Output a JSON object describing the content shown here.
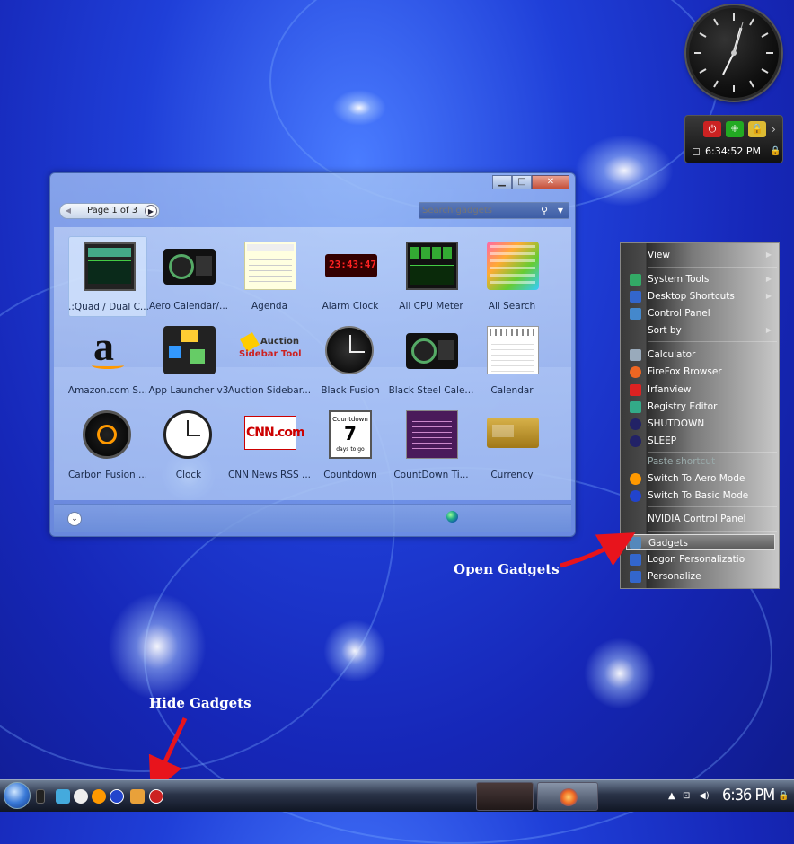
{
  "clock_gadget": {
    "label": "analog clock"
  },
  "power_gadget": {
    "time": "6:34:52 PM"
  },
  "gallery": {
    "page_text": "Page 1 of 3",
    "search_placeholder": "Search gadgets",
    "gadgets": [
      {
        "label": ".:Quad / Dual C...",
        "thumb": "cpu-meter"
      },
      {
        "label": "Aero Calendar/...",
        "thumb": "aero-calendar"
      },
      {
        "label": "Agenda",
        "thumb": "agenda"
      },
      {
        "label": "Alarm Clock",
        "thumb": "alarm-clock"
      },
      {
        "label": "All CPU Meter",
        "thumb": "all-cpu-meter"
      },
      {
        "label": "All Search",
        "thumb": "all-search"
      },
      {
        "label": "Amazon.com S...",
        "thumb": "amazon"
      },
      {
        "label": "App Launcher v3",
        "thumb": "app-launcher"
      },
      {
        "label": "Auction Sidebar...",
        "thumb": "auction-sidebar"
      },
      {
        "label": "Black Fusion",
        "thumb": "black-fusion"
      },
      {
        "label": "Black Steel Cale...",
        "thumb": "black-steel"
      },
      {
        "label": "Calendar",
        "thumb": "calendar"
      },
      {
        "label": "Carbon Fusion ...",
        "thumb": "carbon-fusion"
      },
      {
        "label": "Clock",
        "thumb": "clock"
      },
      {
        "label": "CNN News RSS ...",
        "thumb": "cnn"
      },
      {
        "label": "Countdown",
        "thumb": "countdown"
      },
      {
        "label": "CountDown Ti...",
        "thumb": "countdown-timer"
      },
      {
        "label": "Currency",
        "thumb": "currency"
      }
    ],
    "alarm_text": "23:43:47",
    "cnn_text": "CNN.com",
    "countdown_text": "Countdown",
    "countdown_num": "7",
    "countdown_sub": "days to go",
    "auction_text1": "Auction",
    "auction_text2": "Sidebar Tool"
  },
  "context_menu": {
    "items": [
      {
        "label": "View",
        "submenu": true,
        "icon": ""
      },
      {
        "label": "System Tools",
        "submenu": true,
        "icon": "system-tools-icon"
      },
      {
        "label": "Desktop Shortcuts",
        "submenu": true,
        "icon": "desktop-shortcuts-icon"
      },
      {
        "label": "Control Panel",
        "submenu": false,
        "icon": "control-panel-icon"
      },
      {
        "label": "Sort by",
        "submenu": true,
        "icon": ""
      },
      {
        "label": "Calculator",
        "submenu": false,
        "icon": "calculator-icon"
      },
      {
        "label": "FireFox Browser",
        "submenu": false,
        "icon": "firefox-icon"
      },
      {
        "label": "Irfanview",
        "submenu": false,
        "icon": "irfanview-icon"
      },
      {
        "label": "Registry Editor",
        "submenu": false,
        "icon": "registry-editor-icon"
      },
      {
        "label": "SHUTDOWN",
        "submenu": false,
        "icon": "shutdown-icon"
      },
      {
        "label": "SLEEP",
        "submenu": false,
        "icon": "sleep-icon"
      },
      {
        "label": "Paste shortcut",
        "submenu": false,
        "icon": ""
      },
      {
        "label": "Switch To Aero Mode",
        "submenu": false,
        "icon": "aero-mode-icon"
      },
      {
        "label": "Switch To Basic Mode",
        "submenu": false,
        "icon": "basic-mode-icon"
      },
      {
        "label": "NVIDIA Control Panel",
        "submenu": false,
        "icon": ""
      },
      {
        "label": "Gadgets",
        "submenu": false,
        "icon": "gadgets-icon"
      },
      {
        "label": "Logon Personalizatio",
        "submenu": false,
        "icon": "logon-icon"
      },
      {
        "label": "Personalize",
        "submenu": false,
        "icon": "personalize-icon"
      }
    ]
  },
  "annotations": {
    "open_gadgets": "Open Gadgets",
    "hide_gadgets": "Hide Gadgets"
  },
  "taskbar": {
    "clock": "6:36 PM"
  },
  "colors": {
    "desktop": "#1f3fd8",
    "arrow": "#e8141c"
  }
}
